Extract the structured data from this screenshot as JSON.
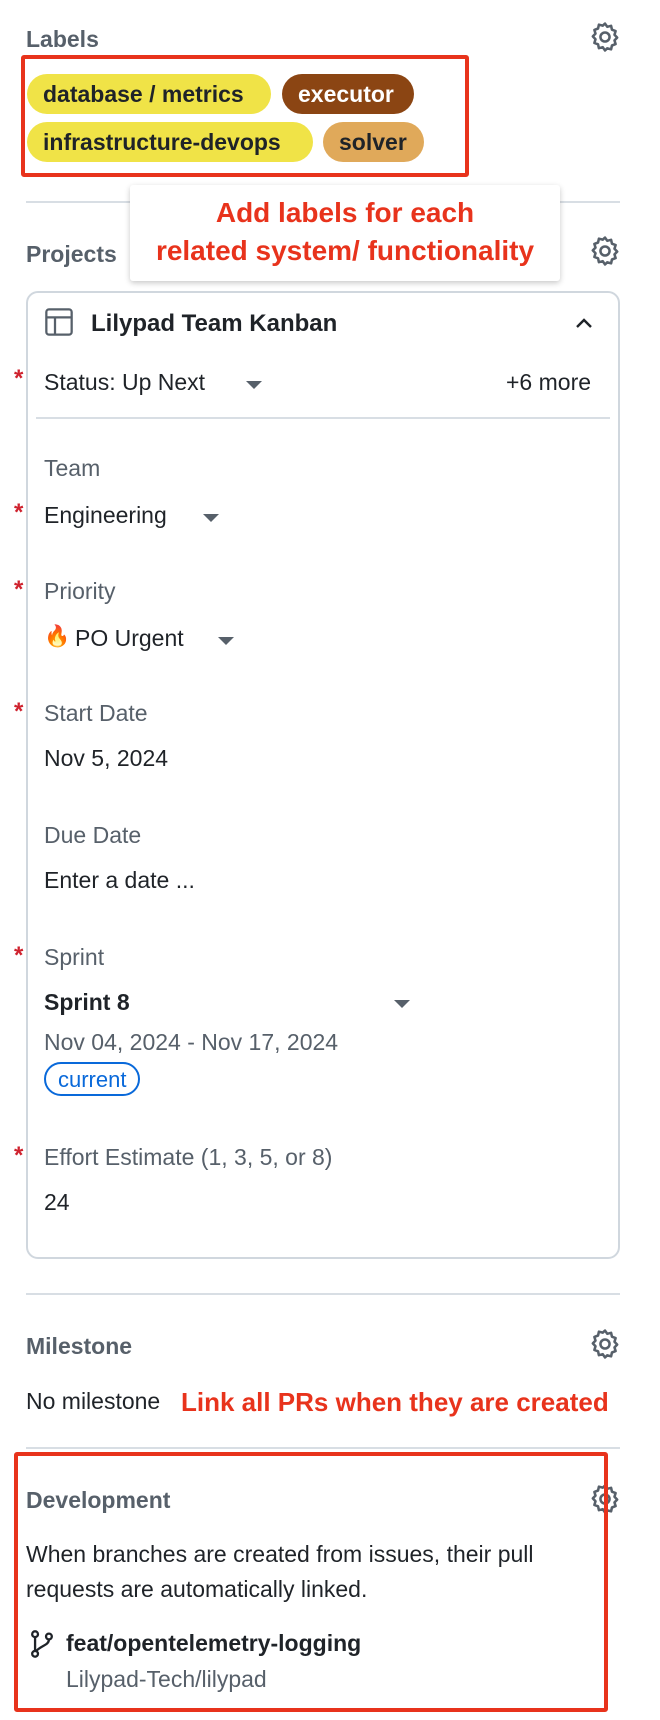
{
  "labels": {
    "title": "Labels",
    "items": [
      {
        "name": "database / metrics",
        "bg": "#f0e347",
        "fg": "#1f2328"
      },
      {
        "name": "executor",
        "bg": "#8b4513",
        "fg": "#ffffff"
      },
      {
        "name": "infrastructure-devops",
        "bg": "#f0e347",
        "fg": "#1f2328"
      },
      {
        "name": "solver",
        "bg": "#e0a95a",
        "fg": "#1f2328"
      }
    ],
    "annotation_line1": "Add labels for each",
    "annotation_line2": "related system/ functionality"
  },
  "projects": {
    "title": "Projects",
    "project_name": "Lilypad Team Kanban",
    "status": "Status: Up Next",
    "more": "+6 more",
    "fields": {
      "team_label": "Team",
      "team_value": "Engineering",
      "priority_label": "Priority",
      "priority_emoji": "🔥",
      "priority_value": "PO Urgent",
      "start_label": "Start Date",
      "start_value": "Nov 5, 2024",
      "due_label": "Due Date",
      "due_placeholder": "Enter a date ...",
      "sprint_label": "Sprint",
      "sprint_value": "Sprint 8",
      "sprint_range": "Nov 04, 2024 - Nov 17, 2024",
      "sprint_badge": "current",
      "effort_label": "Effort Estimate (1, 3, 5, or 8)",
      "effort_value": "24"
    },
    "required_marker": "*"
  },
  "milestone": {
    "title": "Milestone",
    "value": "No milestone",
    "annotation": "Link all PRs when they are created"
  },
  "development": {
    "title": "Development",
    "description_line1": "When branches are created from issues, their pull",
    "description_line2": "requests are automatically linked.",
    "branch": "feat/opentelemetry-logging",
    "repo": "Lilypad-Tech/lilypad"
  },
  "icons": {
    "gear": "gear-icon",
    "table": "table-icon",
    "chevron": "chevron-up-icon",
    "branch": "git-branch-icon"
  },
  "colors": {
    "annotation_red": "#e8331c",
    "required_red": "#cf222e",
    "badge_blue": "#0969da",
    "muted": "#57606a"
  }
}
